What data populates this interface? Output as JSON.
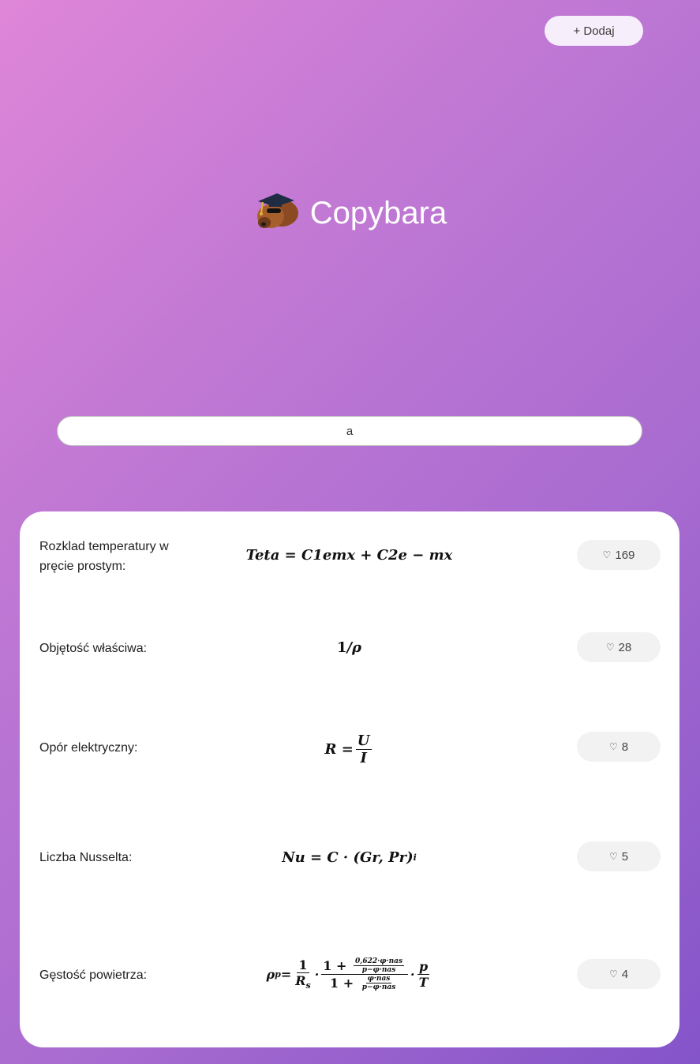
{
  "header": {
    "add_button_label": "+ Dodaj"
  },
  "brand": {
    "title": "Copybara",
    "logo_icon": "capybara-graduate-icon"
  },
  "search": {
    "value": "a"
  },
  "colors": {
    "gradient_start": "#df86d8",
    "gradient_end": "#8454c9",
    "card_bg": "#ffffff",
    "like_bg": "#f2f2f2"
  },
  "items": [
    {
      "label": "Rozklad temperatury w pręcie prostym:",
      "formula": "Teta = C1emx + C2e − mx",
      "likes": "169"
    },
    {
      "label": "Objętość właściwa:",
      "formula": "1/ρ",
      "likes": "28"
    },
    {
      "label": "Opór elektryczny:",
      "formula": "R = U/I",
      "likes": "8"
    },
    {
      "label": "Liczba Nusselta:",
      "formula": "Nu = C · (Gr, Pr)^i",
      "likes": "5"
    },
    {
      "label": "Gęstość powietrza:",
      "formula": "ρp = 1/Rs · (1 + 0,622·φ·nas/(p−φ·nas))/(1 + φ·nas/(p−φ·nas)) · p/T",
      "likes": "4"
    }
  ]
}
